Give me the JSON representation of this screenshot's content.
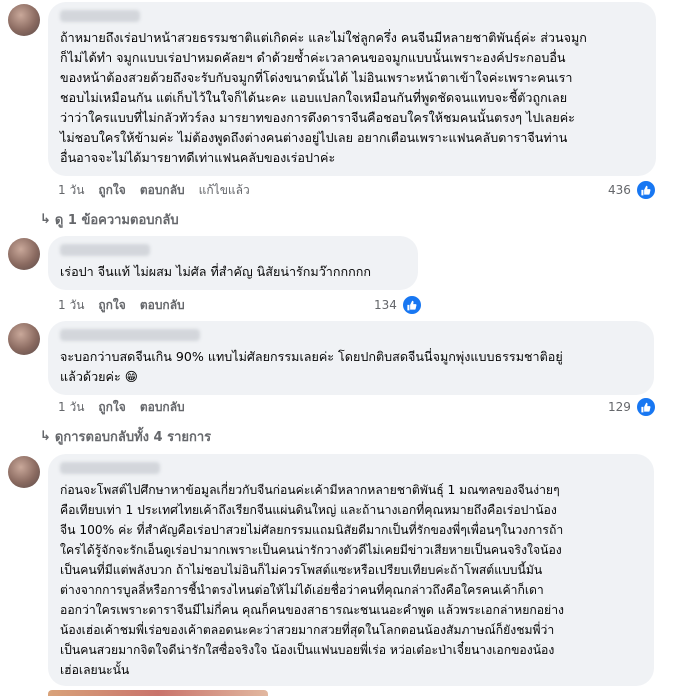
{
  "comments": [
    {
      "text": "ถ้าหมายถึงเร่อปาหน้าสวยธรรมชาติแต่เกิดค่ะ และไม่ใช่ลูกครึ่ง คนจีนมีหลายชาติพันธุ์ค่ะ ส่วนจมูก\nก็ไม่ได้ทำ จมูกแบบเร่อปาหมดคัลยฯ ดำด้วยซ้ำค่ะเวลาคนขอจมูกแบบนั้นเพราะองค์ประกอบอื่น\nของหน้าต้องสวยด้วยถึงจะรับกับจมูกที่โด่งขนาดนั้นได้ ไม่อินเพราะหน้าตาเข้าใจค่ะเพราะคนเรา\nชอบไม่เหมือนกัน แต่เก็บไว้ในใจก็ได้นะคะ แอบแปลกใจเหมือนกันที่พูดชัดจนแทบจะชี้ตัวถูกเลย\nว่าว่าใครแบบที่ไม่กลัวทัวร์ลง มารยาทของการดึงดาราจีนคือชอบใครให้ชมคนนั้นตรงๆ ไปเลยค่ะ\nไม่ชอบใครให้ข้ามค่ะ ไม่ต้องพูดถึงต่างคนต่างอยู่ไปเลย อยากเตือนเพราะแฟนคลับดาราจีนท่าน\nอื่นอาจจะไม่ได้มารยาทดีเท่าแฟนคลับของเร่อปาค่ะ",
      "time": "1 วัน",
      "like": "ถูกใจ",
      "reply": "ตอบกลับ",
      "edited": "แก้ไขแล้ว",
      "reactions": "436"
    },
    {
      "text": "เร่อปา จีนแท้ ไม่ผสม ไม่ศัล ที่สำคัญ นิสัยน่ารักมว๊ากกกกก",
      "time": "1 วัน",
      "like": "ถูกใจ",
      "reply": "ตอบกลับ",
      "reactions": "134"
    },
    {
      "text": "จะบอกว่าบสดจีนเกิน 90% แทบไม่ศัลยกรรมเลยค่ะ โดยปกติบสดจีนนี่จมูกพุ่งแบบธรรมชาติอยู่\nแล้วด้วยค่ะ 😁",
      "time": "1 วัน",
      "like": "ถูกใจ",
      "reply": "ตอบกลับ",
      "reactions": "129"
    },
    {
      "text": "ก่อนจะโพสต์ไปศึกษาหาข้อมูลเกี่ยวกับจีนก่อนค่ะเค้ามีหลากหลายชาติพันธุ์ 1 มณฑลของจีนง่ายๆ\nคือเทียบเท่า 1 ประเทศไทยเค้าถึงเรียกจีนแผ่นดินใหญ่ และถ้านางเอกที่คุณหมายถึงคือเร่อปาน้อง\nจีน 100% ค่ะ ที่สำคัญคือเร่อปาสวยไม่ศัลยกรรมแถมนิสัยดีมากเป็นที่รักของพี่ๆเพื่อนๆในวงการถ้า\nใครได้รู้จักจะรักเอ็นดูเร่อปามากเพราะเป็นคนน่ารักวางตัวดีไม่เคยมีข่าวเสียหายเป็นคนจริงใจน้อง\nเป็นคนที่มีแต่พลังบวก ถ้าไม่ชอบไม่อินก็ไม่ควรโพสต์แซะหรือเปรียบเทียบค่ะถ้าโพสต์แบบนี้มัน\nต่างจากการบูลลี่หรือการชี้นำตรงไหนต่อให้ไม่ได้เอ่ยชื่อว่าคนที่คุณกล่าวถึงคือใครคนเค้าก็เดา\nออกว่าใครเพราะดาราจีนมีไม่กี่คน คุณก็คนของสาธารณะชนเนอะคำพูด แล้วพระเอกล่าหยกอย่าง\nน้องเฮ่อเค้าชมพี่เร่อของเค้าตลอดนะคะว่าสวยมากสวยที่สุดในโลกตอนน้องสัมภาษณ์ก็ยังชมพี่ว่า\nเป็นคนสวยมากจิตใจดีน่ารักใสซื่อจริงใจ น้องเป็นแฟนบอยพี่เร่อ หว่อเต๋อะป่าเจี๋ยนางเอกของน้อง\nเฮ่อเลยนะนั้น"
    }
  ],
  "toggles": {
    "one_reply": "ดู 1 ข้อความตอบกลับ",
    "all_replies": "ดูการตอบกลับทั้ง 4 รายการ"
  },
  "colors": {
    "bubble": "#f0f2f5",
    "meta": "#65676b",
    "like_blue": "#1877f2"
  }
}
